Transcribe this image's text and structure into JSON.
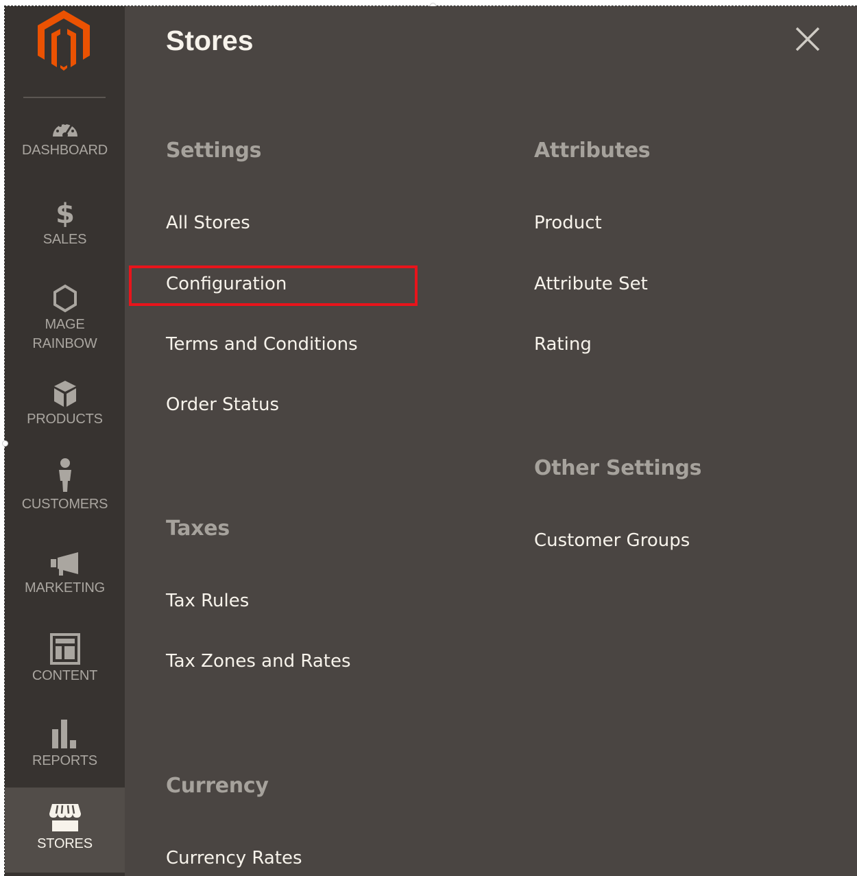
{
  "sidebar": {
    "logo_icon": "magento-logo-icon",
    "items": [
      {
        "label": "DASHBOARD",
        "icon": "dashboard-gauge-icon"
      },
      {
        "label": "SALES",
        "icon": "dollar-icon"
      },
      {
        "label": "MAGE\nRAINBOW",
        "icon": "hexagon-icon"
      },
      {
        "label": "PRODUCTS",
        "icon": "cube-icon"
      },
      {
        "label": "CUSTOMERS",
        "icon": "person-icon"
      },
      {
        "label": "MARKETING",
        "icon": "megaphone-icon"
      },
      {
        "label": "CONTENT",
        "icon": "layout-icon"
      },
      {
        "label": "REPORTS",
        "icon": "bar-chart-icon"
      },
      {
        "label": "STORES",
        "icon": "storefront-icon",
        "active": true
      }
    ]
  },
  "panel": {
    "title": "Stores",
    "close_icon": "close-icon",
    "sections": {
      "settings": {
        "title": "Settings",
        "links": [
          "All Stores",
          "Configuration",
          "Terms and Conditions",
          "Order Status"
        ]
      },
      "taxes": {
        "title": "Taxes",
        "links": [
          "Tax Rules",
          "Tax Zones and Rates"
        ]
      },
      "currency": {
        "title": "Currency",
        "links": [
          "Currency Rates"
        ]
      },
      "attributes": {
        "title": "Attributes",
        "links": [
          "Product",
          "Attribute Set",
          "Rating"
        ]
      },
      "other_settings": {
        "title": "Other Settings",
        "links": [
          "Customer Groups"
        ]
      }
    },
    "highlighted_link": "Configuration"
  },
  "colors": {
    "sidebar_bg": "#373330",
    "sidebar_active_bg": "#524d49",
    "panel_bg": "#4a4542",
    "logo_orange": "#eb5202",
    "highlight_red": "#e8141b",
    "section_title": "#a6a29c",
    "link_text": "#f7f3eb"
  }
}
